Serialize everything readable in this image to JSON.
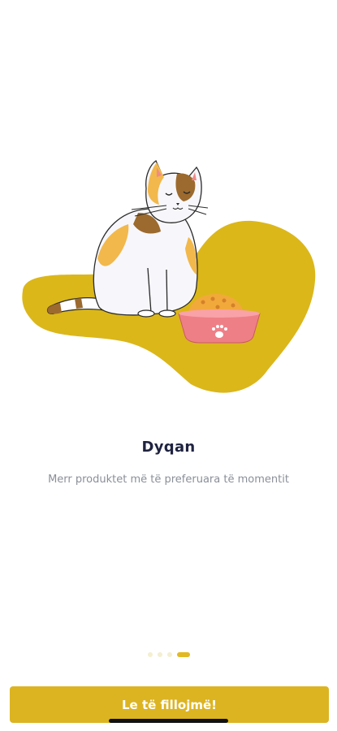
{
  "onboarding": {
    "title": "Dyqan",
    "subtitle": "Merr produktet më të preferuara të momentit",
    "page_count": 4,
    "active_page": 4
  },
  "actions": {
    "start_label": "Le të fillojmë!"
  },
  "colors": {
    "accent": "#dcb422",
    "blob": "#dbb71a",
    "title": "#1f2340",
    "subtitle": "#8a8f98",
    "bowl": "#ef7f86"
  },
  "illustration": {
    "icon": "cat-with-food-bowl-illustration"
  }
}
